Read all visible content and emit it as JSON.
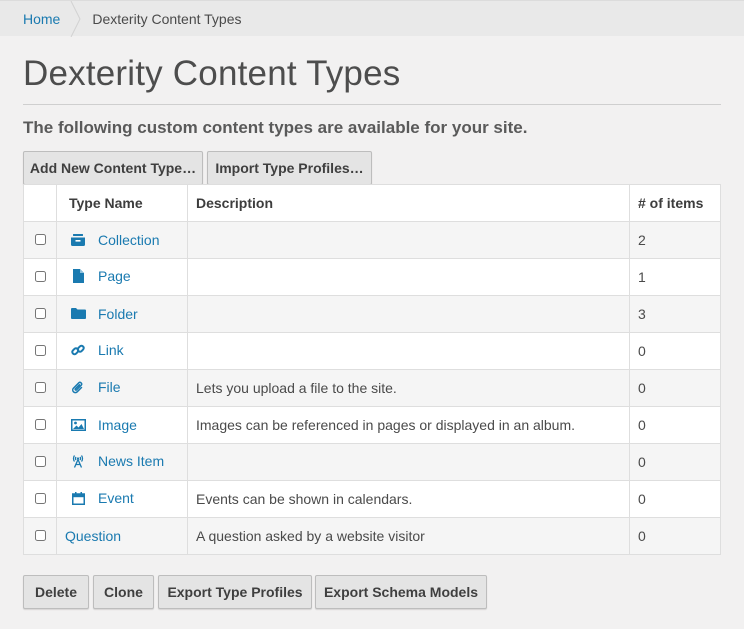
{
  "breadcrumb": {
    "home": "Home",
    "current": "Dexterity Content Types"
  },
  "page_title": "Dexterity Content Types",
  "lead": "The following custom content types are available for your site.",
  "top_buttons": {
    "add": "Add New Content Type…",
    "import": "Import Type Profiles…"
  },
  "table": {
    "headers": [
      "",
      "Type Name",
      "Description",
      "# of items"
    ],
    "rows": [
      {
        "icon": "collection-icon",
        "name": "Collection",
        "description": "",
        "count": "2"
      },
      {
        "icon": "page-icon",
        "name": "Page",
        "description": "",
        "count": "1"
      },
      {
        "icon": "folder-icon",
        "name": "Folder",
        "description": "",
        "count": "3"
      },
      {
        "icon": "link-icon",
        "name": "Link",
        "description": "",
        "count": "0"
      },
      {
        "icon": "paperclip-icon",
        "name": "File",
        "description": "Lets you upload a file to the site.",
        "count": "0"
      },
      {
        "icon": "image-icon",
        "name": "Image",
        "description": "Images can be referenced in pages or displayed in an album.",
        "count": "0"
      },
      {
        "icon": "news-item-icon",
        "name": "News Item",
        "description": "",
        "count": "0"
      },
      {
        "icon": "calendar-icon",
        "name": "Event",
        "description": "Events can be shown in calendars.",
        "count": "0"
      },
      {
        "icon": "",
        "name": "Question",
        "description": "A question asked by a website visitor",
        "count": "0"
      }
    ]
  },
  "bottom_buttons": {
    "delete": "Delete",
    "clone": "Clone",
    "export_profiles": "Export Type Profiles",
    "export_models": "Export Schema Models"
  },
  "colors": {
    "link": "#1a7ab0",
    "background": "#f2f1f1",
    "button": "#e4e4e4"
  }
}
